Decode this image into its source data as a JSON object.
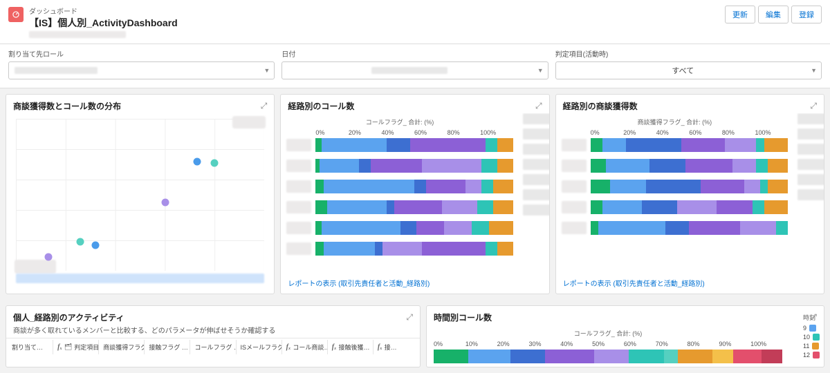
{
  "breadcrumb": "ダッシュボード",
  "page_title": "【IS】個人別_ActivityDashboard",
  "buttons": {
    "refresh": "更新",
    "edit": "編集",
    "register": "登録"
  },
  "filters": {
    "role": {
      "label": "割り当て先ロール"
    },
    "date": {
      "label": "日付"
    },
    "decision": {
      "label": "判定項目(活動時)",
      "value": "すべて"
    }
  },
  "card1": {
    "title": "商談獲得数とコール数の分布",
    "points": [
      {
        "x": 13,
        "y": 91,
        "color": "#a88fe8"
      },
      {
        "x": 26,
        "y": 81,
        "color": "#55d0c0"
      },
      {
        "x": 32,
        "y": 83,
        "color": "#4a9bea"
      },
      {
        "x": 60,
        "y": 55,
        "color": "#a88fe8"
      },
      {
        "x": 73,
        "y": 28,
        "color": "#4a9bea"
      },
      {
        "x": 80,
        "y": 29,
        "color": "#55d0c0"
      }
    ]
  },
  "card2": {
    "title": "経路別のコール数",
    "axis_title": "コールフラグ_ 合計: (%)",
    "ticks": [
      "0%",
      "20%",
      "40%",
      "60%",
      "80%",
      "100%"
    ],
    "rows": [
      {
        "segs": [
          {
            "w": 3,
            "c": "#17b169"
          },
          {
            "w": 33,
            "c": "#5ba3ef"
          },
          {
            "w": 12,
            "c": "#3d6fd1"
          },
          {
            "w": 20,
            "c": "#8c60d6"
          },
          {
            "w": 18,
            "c": "#8c60d6"
          },
          {
            "w": 6,
            "c": "#2ec4b6"
          },
          {
            "w": 8,
            "c": "#e69a2e"
          }
        ]
      },
      {
        "segs": [
          {
            "w": 2,
            "c": "#17b169"
          },
          {
            "w": 20,
            "c": "#5ba3ef"
          },
          {
            "w": 6,
            "c": "#3d6fd1"
          },
          {
            "w": 26,
            "c": "#8c60d6"
          },
          {
            "w": 30,
            "c": "#a88fe8"
          },
          {
            "w": 8,
            "c": "#2ec4b6"
          },
          {
            "w": 8,
            "c": "#e69a2e"
          }
        ]
      },
      {
        "segs": [
          {
            "w": 4,
            "c": "#17b169"
          },
          {
            "w": 46,
            "c": "#5ba3ef"
          },
          {
            "w": 6,
            "c": "#3d6fd1"
          },
          {
            "w": 20,
            "c": "#8c60d6"
          },
          {
            "w": 8,
            "c": "#a88fe8"
          },
          {
            "w": 6,
            "c": "#2ec4b6"
          },
          {
            "w": 10,
            "c": "#e69a2e"
          }
        ]
      },
      {
        "segs": [
          {
            "w": 6,
            "c": "#17b169"
          },
          {
            "w": 30,
            "c": "#5ba3ef"
          },
          {
            "w": 4,
            "c": "#3d6fd1"
          },
          {
            "w": 24,
            "c": "#8c60d6"
          },
          {
            "w": 18,
            "c": "#a88fe8"
          },
          {
            "w": 8,
            "c": "#2ec4b6"
          },
          {
            "w": 10,
            "c": "#e69a2e"
          }
        ]
      },
      {
        "segs": [
          {
            "w": 3,
            "c": "#17b169"
          },
          {
            "w": 40,
            "c": "#5ba3ef"
          },
          {
            "w": 8,
            "c": "#3d6fd1"
          },
          {
            "w": 14,
            "c": "#8c60d6"
          },
          {
            "w": 14,
            "c": "#a88fe8"
          },
          {
            "w": 9,
            "c": "#2ec4b6"
          },
          {
            "w": 12,
            "c": "#e69a2e"
          }
        ]
      },
      {
        "segs": [
          {
            "w": 4,
            "c": "#17b169"
          },
          {
            "w": 26,
            "c": "#5ba3ef"
          },
          {
            "w": 4,
            "c": "#3d6fd1"
          },
          {
            "w": 20,
            "c": "#a88fe8"
          },
          {
            "w": 32,
            "c": "#8c60d6"
          },
          {
            "w": 6,
            "c": "#2ec4b6"
          },
          {
            "w": 8,
            "c": "#e69a2e"
          }
        ]
      }
    ],
    "footer": "レポートの表示 (取引先責任者と活動_経路別)"
  },
  "card3": {
    "title": "経路別の商談獲得数",
    "axis_title": "商談獲得フラグ_ 合計: (%)",
    "ticks": [
      "0%",
      "20%",
      "40%",
      "60%",
      "80%",
      "100%"
    ],
    "rows": [
      {
        "segs": [
          {
            "w": 6,
            "c": "#17b169"
          },
          {
            "w": 12,
            "c": "#5ba3ef"
          },
          {
            "w": 28,
            "c": "#3d6fd1"
          },
          {
            "w": 22,
            "c": "#8c60d6"
          },
          {
            "w": 16,
            "c": "#a88fe8"
          },
          {
            "w": 4,
            "c": "#2ec4b6"
          },
          {
            "w": 12,
            "c": "#e69a2e"
          }
        ]
      },
      {
        "segs": [
          {
            "w": 8,
            "c": "#17b169"
          },
          {
            "w": 22,
            "c": "#5ba3ef"
          },
          {
            "w": 18,
            "c": "#3d6fd1"
          },
          {
            "w": 24,
            "c": "#8c60d6"
          },
          {
            "w": 12,
            "c": "#a88fe8"
          },
          {
            "w": 6,
            "c": "#2ec4b6"
          },
          {
            "w": 10,
            "c": "#e69a2e"
          }
        ]
      },
      {
        "segs": [
          {
            "w": 10,
            "c": "#17b169"
          },
          {
            "w": 18,
            "c": "#5ba3ef"
          },
          {
            "w": 28,
            "c": "#3d6fd1"
          },
          {
            "w": 22,
            "c": "#8c60d6"
          },
          {
            "w": 8,
            "c": "#a88fe8"
          },
          {
            "w": 4,
            "c": "#2ec4b6"
          },
          {
            "w": 10,
            "c": "#e69a2e"
          }
        ]
      },
      {
        "segs": [
          {
            "w": 6,
            "c": "#17b169"
          },
          {
            "w": 20,
            "c": "#5ba3ef"
          },
          {
            "w": 18,
            "c": "#3d6fd1"
          },
          {
            "w": 20,
            "c": "#a88fe8"
          },
          {
            "w": 18,
            "c": "#8c60d6"
          },
          {
            "w": 6,
            "c": "#2ec4b6"
          },
          {
            "w": 12,
            "c": "#e69a2e"
          }
        ]
      },
      {
        "segs": [
          {
            "w": 4,
            "c": "#17b169"
          },
          {
            "w": 34,
            "c": "#5ba3ef"
          },
          {
            "w": 12,
            "c": "#3d6fd1"
          },
          {
            "w": 26,
            "c": "#8c60d6"
          },
          {
            "w": 18,
            "c": "#a88fe8"
          },
          {
            "w": 6,
            "c": "#2ec4b6"
          }
        ]
      }
    ],
    "footer": "レポートの表示 (取引先責任者と活動_経路別)"
  },
  "card4": {
    "title": "個人_経路別のアクティビティ",
    "subtitle": "商談が多く取れているメンバーと比較する、どのパラメータが伸ばせそうか確認する",
    "columns": [
      "割り当て…",
      "判定項目(活動時)まと…",
      "商談獲得フラグ …",
      "接触フラグ …",
      "コールフラグ …",
      "ISメールフラグ …",
      "コール商談…",
      "接触後獲…",
      "接…"
    ],
    "fx_cols": [
      false,
      true,
      false,
      false,
      false,
      false,
      true,
      true,
      true
    ]
  },
  "card5": {
    "title": "時間別コール数",
    "axis_title": "コールフラグ_ 合計: (%)",
    "ticks": [
      "0%",
      "10%",
      "20%",
      "30%",
      "40%",
      "50%",
      "60%",
      "70%",
      "80%",
      "90%",
      "100%"
    ],
    "legend_title": "時刻",
    "legend": [
      {
        "label": "9",
        "color": "#5ba3ef"
      },
      {
        "label": "10",
        "color": "#2ec4b6"
      },
      {
        "label": "11",
        "color": "#e69a2e"
      },
      {
        "label": "12",
        "color": "#e34f6c"
      }
    ],
    "bar": [
      {
        "w": 10,
        "c": "#17b169"
      },
      {
        "w": 12,
        "c": "#5ba3ef"
      },
      {
        "w": 10,
        "c": "#3d6fd1"
      },
      {
        "w": 14,
        "c": "#8c60d6"
      },
      {
        "w": 10,
        "c": "#a88fe8"
      },
      {
        "w": 10,
        "c": "#2ec4b6"
      },
      {
        "w": 4,
        "c": "#55d0c0"
      },
      {
        "w": 10,
        "c": "#e69a2e"
      },
      {
        "w": 6,
        "c": "#f4c04a"
      },
      {
        "w": 8,
        "c": "#e34f6c"
      },
      {
        "w": 6,
        "c": "#c23d58"
      }
    ]
  },
  "chart_data": [
    {
      "type": "scatter",
      "title": "商談獲得数とコール数の分布",
      "points": [
        {
          "x": 13,
          "y": 9
        },
        {
          "x": 26,
          "y": 19
        },
        {
          "x": 32,
          "y": 17
        },
        {
          "x": 60,
          "y": 45
        },
        {
          "x": 73,
          "y": 72
        },
        {
          "x": 80,
          "y": 71
        }
      ]
    },
    {
      "type": "bar",
      "title": "経路別のコール数",
      "orientation": "horizontal",
      "stacked": true,
      "unit": "%",
      "xlabel": "コールフラグ_ 合計: (%)",
      "xlim": [
        0,
        100
      ],
      "rows_count": 6
    },
    {
      "type": "bar",
      "title": "経路別の商談獲得数",
      "orientation": "horizontal",
      "stacked": true,
      "unit": "%",
      "xlabel": "商談獲得フラグ_ 合計: (%)",
      "xlim": [
        0,
        100
      ],
      "rows_count": 5
    },
    {
      "type": "bar",
      "title": "時間別コール数",
      "orientation": "horizontal",
      "stacked": true,
      "unit": "%",
      "xlabel": "コールフラグ_ 合計: (%)",
      "xlim": [
        0,
        100
      ],
      "legend_label": "時刻",
      "legend_values": [
        9,
        10,
        11,
        12
      ]
    }
  ]
}
